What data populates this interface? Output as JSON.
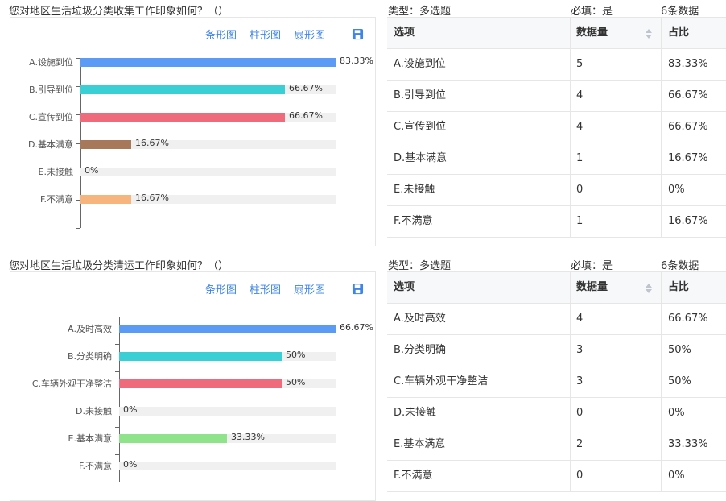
{
  "labels": {
    "tab_bar": "条形图",
    "tab_column": "柱形图",
    "tab_pie": "扇形图",
    "col_option": "选项",
    "col_count": "数据量",
    "col_ratio": "占比"
  },
  "icons": {
    "save": "save-icon",
    "sort": "sort-icon"
  },
  "colors": {
    "accent": "#3f85e8",
    "track": "#f0f0f0",
    "border": "#e6e6e6"
  },
  "questions": [
    {
      "title": "您对地区生活垃圾分类收集工作印象如何？（）",
      "type_text": "类型：多选题",
      "required_text": "必填：是",
      "count_text": "6条数据",
      "chart_data": {
        "type": "bar",
        "orientation": "horizontal",
        "categories": [
          "A.设施到位",
          "B.引导到位",
          "C.宣传到位",
          "D.基本满意",
          "E.未接触",
          "F.不满意"
        ],
        "values": [
          83.33,
          66.67,
          66.67,
          16.67,
          0,
          16.67
        ],
        "value_labels": [
          "83.33%",
          "66.67%",
          "66.67%",
          "16.67%",
          "0%",
          "16.67%"
        ],
        "colors": [
          "#5b9bf5",
          "#3acfd5",
          "#ef6b7b",
          "#a7785a",
          "#a7785a",
          "#f7b57d"
        ],
        "xlim": [
          0,
          83.33
        ]
      },
      "rows": [
        {
          "option": "A.设施到位",
          "count": "5",
          "ratio": "83.33%"
        },
        {
          "option": "B.引导到位",
          "count": "4",
          "ratio": "66.67%"
        },
        {
          "option": "C.宣传到位",
          "count": "4",
          "ratio": "66.67%"
        },
        {
          "option": "D.基本满意",
          "count": "1",
          "ratio": "16.67%"
        },
        {
          "option": "E.未接触",
          "count": "0",
          "ratio": "0%"
        },
        {
          "option": "F.不满意",
          "count": "1",
          "ratio": "16.67%"
        }
      ]
    },
    {
      "title": "您对地区生活垃圾分类清运工作印象如何？（）",
      "type_text": "类型：多选题",
      "required_text": "必填：是",
      "count_text": "6条数据",
      "chart_data": {
        "type": "bar",
        "orientation": "horizontal",
        "categories": [
          "A.及时高效",
          "B.分类明确",
          "C.车辆外观干净整洁",
          "D.未接触",
          "E.基本满意",
          "F.不满意"
        ],
        "values": [
          66.67,
          50,
          50,
          0,
          33.33,
          0
        ],
        "value_labels": [
          "66.67%",
          "50%",
          "50%",
          "0%",
          "33.33%",
          "0%"
        ],
        "colors": [
          "#5b9bf5",
          "#3acfd5",
          "#ef6b7b",
          "#a7785a",
          "#8fe38b",
          "#f7b57d"
        ],
        "xlim": [
          0,
          66.67
        ]
      },
      "rows": [
        {
          "option": "A.及时高效",
          "count": "4",
          "ratio": "66.67%"
        },
        {
          "option": "B.分类明确",
          "count": "3",
          "ratio": "50%"
        },
        {
          "option": "C.车辆外观干净整洁",
          "count": "3",
          "ratio": "50%"
        },
        {
          "option": "D.未接触",
          "count": "0",
          "ratio": "0%"
        },
        {
          "option": "E.基本满意",
          "count": "2",
          "ratio": "33.33%"
        },
        {
          "option": "F.不满意",
          "count": "0",
          "ratio": "0%"
        }
      ]
    }
  ]
}
